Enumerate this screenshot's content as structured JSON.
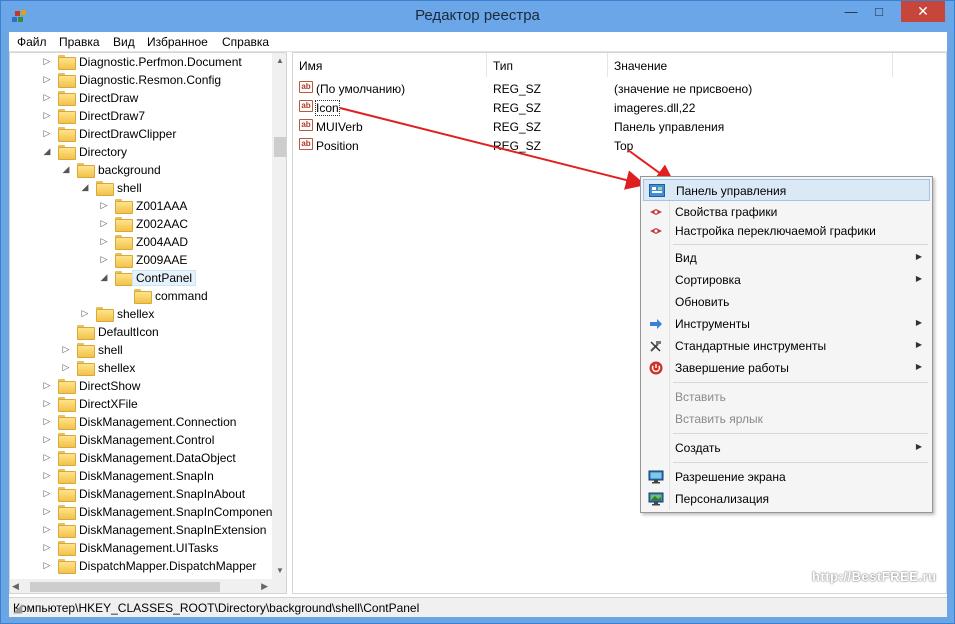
{
  "window": {
    "title": "Редактор реестра",
    "close_glyph": "✕",
    "minimize_glyph": "—",
    "maximize_glyph": "□",
    "title_bar_color": "#6ba7e8",
    "close_color": "#c7463b"
  },
  "menubar": [
    "Файл",
    "Правка",
    "Вид",
    "Избранное",
    "Справка"
  ],
  "tree": [
    {
      "label": "Diagnostic.Perfmon.Document",
      "expander": "▷"
    },
    {
      "label": "Diagnostic.Resmon.Config",
      "expander": "▷"
    },
    {
      "label": "DirectDraw",
      "expander": "▷"
    },
    {
      "label": "DirectDraw7",
      "expander": "▷"
    },
    {
      "label": "DirectDrawClipper",
      "expander": "▷"
    },
    {
      "label": "Directory",
      "expander": "◢"
    },
    {
      "label": "background",
      "expander": "◢"
    },
    {
      "label": "shell",
      "expander": "◢"
    },
    {
      "label": "Z001AAA",
      "expander": "▷"
    },
    {
      "label": "Z002AAC",
      "expander": "▷"
    },
    {
      "label": "Z004AAD",
      "expander": "▷"
    },
    {
      "label": "Z009AAE",
      "expander": "▷"
    },
    {
      "label": "ContPanel",
      "expander": "◢"
    },
    {
      "label": "command",
      "expander": ""
    },
    {
      "label": "shellex",
      "expander": "▷"
    },
    {
      "label": "DefaultIcon",
      "expander": ""
    },
    {
      "label": "shell",
      "expander": "▷"
    },
    {
      "label": "shellex",
      "expander": "▷"
    },
    {
      "label": "DirectShow",
      "expander": "▷"
    },
    {
      "label": "DirectXFile",
      "expander": "▷"
    },
    {
      "label": "DiskManagement.Connection",
      "expander": "▷"
    },
    {
      "label": "DiskManagement.Control",
      "expander": "▷"
    },
    {
      "label": "DiskManagement.DataObject",
      "expander": "▷"
    },
    {
      "label": "DiskManagement.SnapIn",
      "expander": "▷"
    },
    {
      "label": "DiskManagement.SnapInAbout",
      "expander": "▷"
    },
    {
      "label": "DiskManagement.SnapInComponen",
      "expander": "▷"
    },
    {
      "label": "DiskManagement.SnapInExtension",
      "expander": "▷"
    },
    {
      "label": "DiskManagement.UITasks",
      "expander": "▷"
    },
    {
      "label": "DispatchMapper.DispatchMapper",
      "expander": "▷"
    }
  ],
  "list": {
    "columns": [
      "Имя",
      "Тип",
      "Значение"
    ],
    "rows": [
      {
        "icon": "ab",
        "name": "(По умолчанию)",
        "type": "REG_SZ",
        "value": "(значение не присвоено)"
      },
      {
        "icon": "ab",
        "name": "Icon",
        "type": "REG_SZ",
        "value": "imageres.dll,22"
      },
      {
        "icon": "ab",
        "name": "MUIVerb",
        "type": "REG_SZ",
        "value": "Панель управления"
      },
      {
        "icon": "ab",
        "name": "Position",
        "type": "REG_SZ",
        "value": "Top"
      }
    ]
  },
  "context_menu": {
    "items": [
      {
        "label": "Панель управления",
        "icon": "control-panel-icon",
        "highlighted": true
      },
      {
        "label": "Свойства графики",
        "icon": "graphics-icon"
      },
      {
        "label": "Настройка переключаемой графики",
        "icon": "graphics-icon"
      },
      {
        "label": "Вид",
        "submenu": true
      },
      {
        "label": "Сортировка",
        "submenu": true
      },
      {
        "label": "Обновить"
      },
      {
        "label": "Инструменты",
        "icon": "tools-arrow-icon",
        "submenu": true
      },
      {
        "label": "Стандартные инструменты",
        "icon": "hammer-icon",
        "submenu": true
      },
      {
        "label": "Завершение работы",
        "icon": "power-icon",
        "submenu": true
      },
      {
        "label": "Вставить",
        "disabled": true
      },
      {
        "label": "Вставить ярлык",
        "disabled": true
      },
      {
        "label": "Создать",
        "submenu": true
      },
      {
        "label": "Разрешение экрана",
        "icon": "display-icon"
      },
      {
        "label": "Персонализация",
        "icon": "personalize-icon"
      }
    ],
    "submenu_glyph": "▶"
  },
  "statusbar": {
    "path": "Компьютер\\HKEY_CLASSES_ROOT\\Directory\\background\\shell\\ContPanel"
  },
  "watermark": "http://BestFREE.ru",
  "annotation_color": "#e02020"
}
